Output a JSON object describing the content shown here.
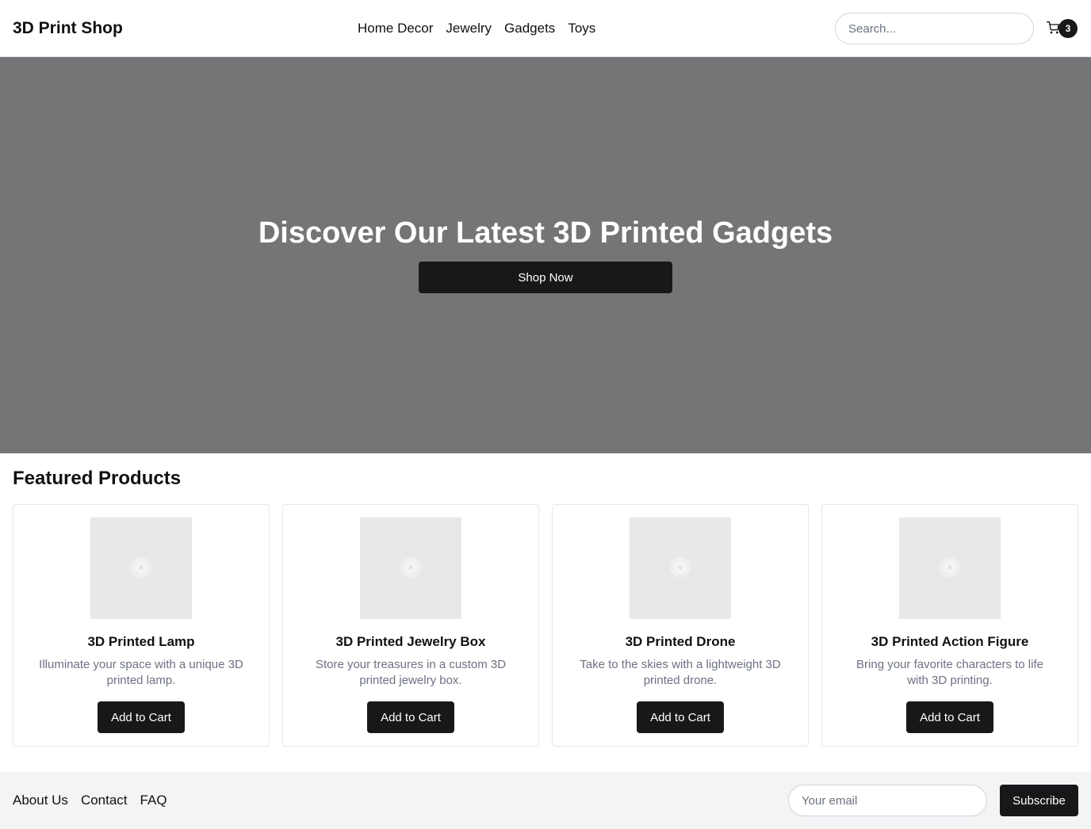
{
  "header": {
    "logo": "3D Print Shop",
    "nav": [
      "Home Decor",
      "Jewelry",
      "Gadgets",
      "Toys"
    ],
    "search_placeholder": "Search...",
    "cart_count": "3",
    "cart_icon": "shopping-cart-icon"
  },
  "hero": {
    "title": "Discover Our Latest 3D Printed Gadgets",
    "button_label": "Shop Now",
    "background_color": "#747577"
  },
  "featured": {
    "title": "Featured Products",
    "products": [
      {
        "name": "3D Printed Lamp",
        "description": "Illuminate your space with a unique 3D printed lamp.",
        "button_label": "Add to Cart",
        "image_icon": "image-placeholder-icon"
      },
      {
        "name": "3D Printed Jewelry Box",
        "description": "Store your treasures in a custom 3D printed jewelry box.",
        "button_label": "Add to Cart",
        "image_icon": "image-placeholder-icon"
      },
      {
        "name": "3D Printed Drone",
        "description": "Take to the skies with a lightweight 3D printed drone.",
        "button_label": "Add to Cart",
        "image_icon": "image-placeholder-icon"
      },
      {
        "name": "3D Printed Action Figure",
        "description": "Bring your favorite characters to life with 3D printing.",
        "button_label": "Add to Cart",
        "image_icon": "image-placeholder-icon"
      }
    ]
  },
  "footer": {
    "links": [
      "About Us",
      "Contact",
      "FAQ"
    ],
    "email_placeholder": "Your email",
    "subscribe_label": "Subscribe"
  },
  "colors": {
    "accent": "#18181b",
    "footer_bg": "#f3f4f6",
    "image_placeholder": "#e8e8e8"
  }
}
